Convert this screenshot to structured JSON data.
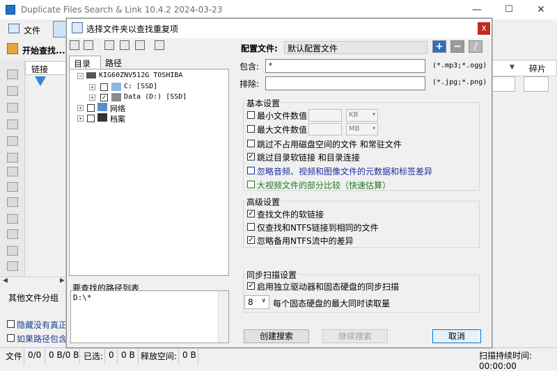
{
  "app": {
    "title": "Duplicate Files Search & Link 10.4.2 2024-03-23",
    "minimize": "—",
    "maximize": "☐",
    "close": "✕"
  },
  "menu": {
    "file": "文件"
  },
  "toolbar": {
    "start_search": "开始查找..."
  },
  "grid": {
    "col_link": "链接",
    "col_fragment": "碎片"
  },
  "main": {
    "other_groups": "其他文件分组",
    "hide_label": "隐藏没有真正:",
    "path_label": "如果路径包含:"
  },
  "status": {
    "file_label": "文件",
    "file_value": "0/0",
    "size_value": "0 B/0 B",
    "selected_label": "已选:",
    "selected_value": "0",
    "selected_size": "0 B",
    "free_label": "释放空间:",
    "free_value": "0 B",
    "scan_time": "扫描持续时间: 00:00:00"
  },
  "dialog": {
    "title": "选择文件夹以查找重复项",
    "close": "x",
    "tabs": {
      "directory": "目录",
      "path": "路径"
    },
    "tree": {
      "root": "KIG60ZNV512G TOSHIBA",
      "drive_c": "C: [SSD]",
      "drive_d": "Data (D:) [SSD]",
      "network": "网络",
      "archive": "档案"
    },
    "pathlist": {
      "label": "要查找的路径列表",
      "entry": "D:\\*"
    },
    "config": {
      "label": "配置文件:",
      "value": "默认配置文件",
      "add": "+",
      "remove": "−",
      "edit": "/"
    },
    "include": {
      "label": "包含:",
      "value": "*",
      "hint": "(*.mp3;*.ogg)"
    },
    "exclude": {
      "label": "排除:",
      "value": "",
      "hint": "(*.jpg;*.png)"
    },
    "basic": {
      "title": "基本设置",
      "min_files": "最小文件数值",
      "max_files": "最大文件数值",
      "min_unit": "KB",
      "max_unit": "MB",
      "skip_unused": "跳过不占用磁盘空间的文件 和常驻文件",
      "skip_links": "跳过目录软链接 和目录连接",
      "ignore_meta": "忽略音频、视频和图像文件的元数据和标签差异",
      "partial_compare": "大视频文件的部分比较（快速估算）"
    },
    "advanced": {
      "title": "高级设置",
      "find_softlinks": "查找文件的软链接",
      "ntfs_same": "仅查找和NTFS链接到相同的文件",
      "ignore_ntfs_streams": "忽略备用NTFS流中的差异"
    },
    "sync": {
      "title": "同步扫描设置",
      "enable_sync": "启用独立驱动器和固态硬盘的同步扫描",
      "max_reads_value": "8",
      "max_reads_label": "每个固态硬盘的最大同时读取量"
    },
    "buttons": {
      "create": "创建搜索",
      "continue": "继续搜索",
      "cancel": "取消"
    },
    "colors": {
      "ignore_meta": "#1a2f9c",
      "partial_compare": "#1d7a1d"
    }
  }
}
